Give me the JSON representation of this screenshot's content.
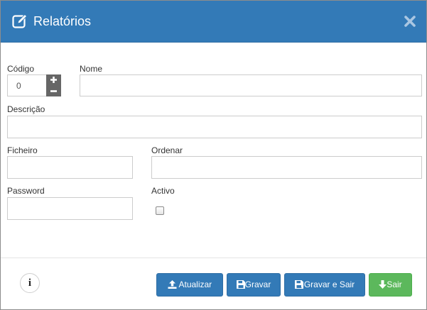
{
  "header": {
    "title": "Relatórios",
    "icon": "edit-icon",
    "close_icon": "close-icon",
    "color": "#337ab7"
  },
  "form": {
    "codigo": {
      "label": "Código",
      "value": "0"
    },
    "nome": {
      "label": "Nome",
      "value": ""
    },
    "descricao": {
      "label": "Descrição",
      "value": ""
    },
    "ficheiro": {
      "label": "Ficheiro",
      "value": ""
    },
    "ordenar": {
      "label": "Ordenar",
      "value": ""
    },
    "password": {
      "label": "Password",
      "value": ""
    },
    "activo": {
      "label": "Activo",
      "checked": false
    }
  },
  "footer": {
    "info_label": "i",
    "buttons": {
      "atualizar": {
        "label": "Atualizar",
        "icon": "upload-icon"
      },
      "gravar": {
        "label": "Gravar",
        "icon": "floppy-disk-icon"
      },
      "gravar_sair": {
        "label": "Gravar e Sair",
        "icon": "floppy-disk-exit-icon"
      },
      "sair": {
        "label": "Sair",
        "icon": "arrow-down-icon"
      }
    }
  },
  "colors": {
    "primary": "#337ab7",
    "success": "#5cb85c",
    "stepper": "#666666"
  }
}
